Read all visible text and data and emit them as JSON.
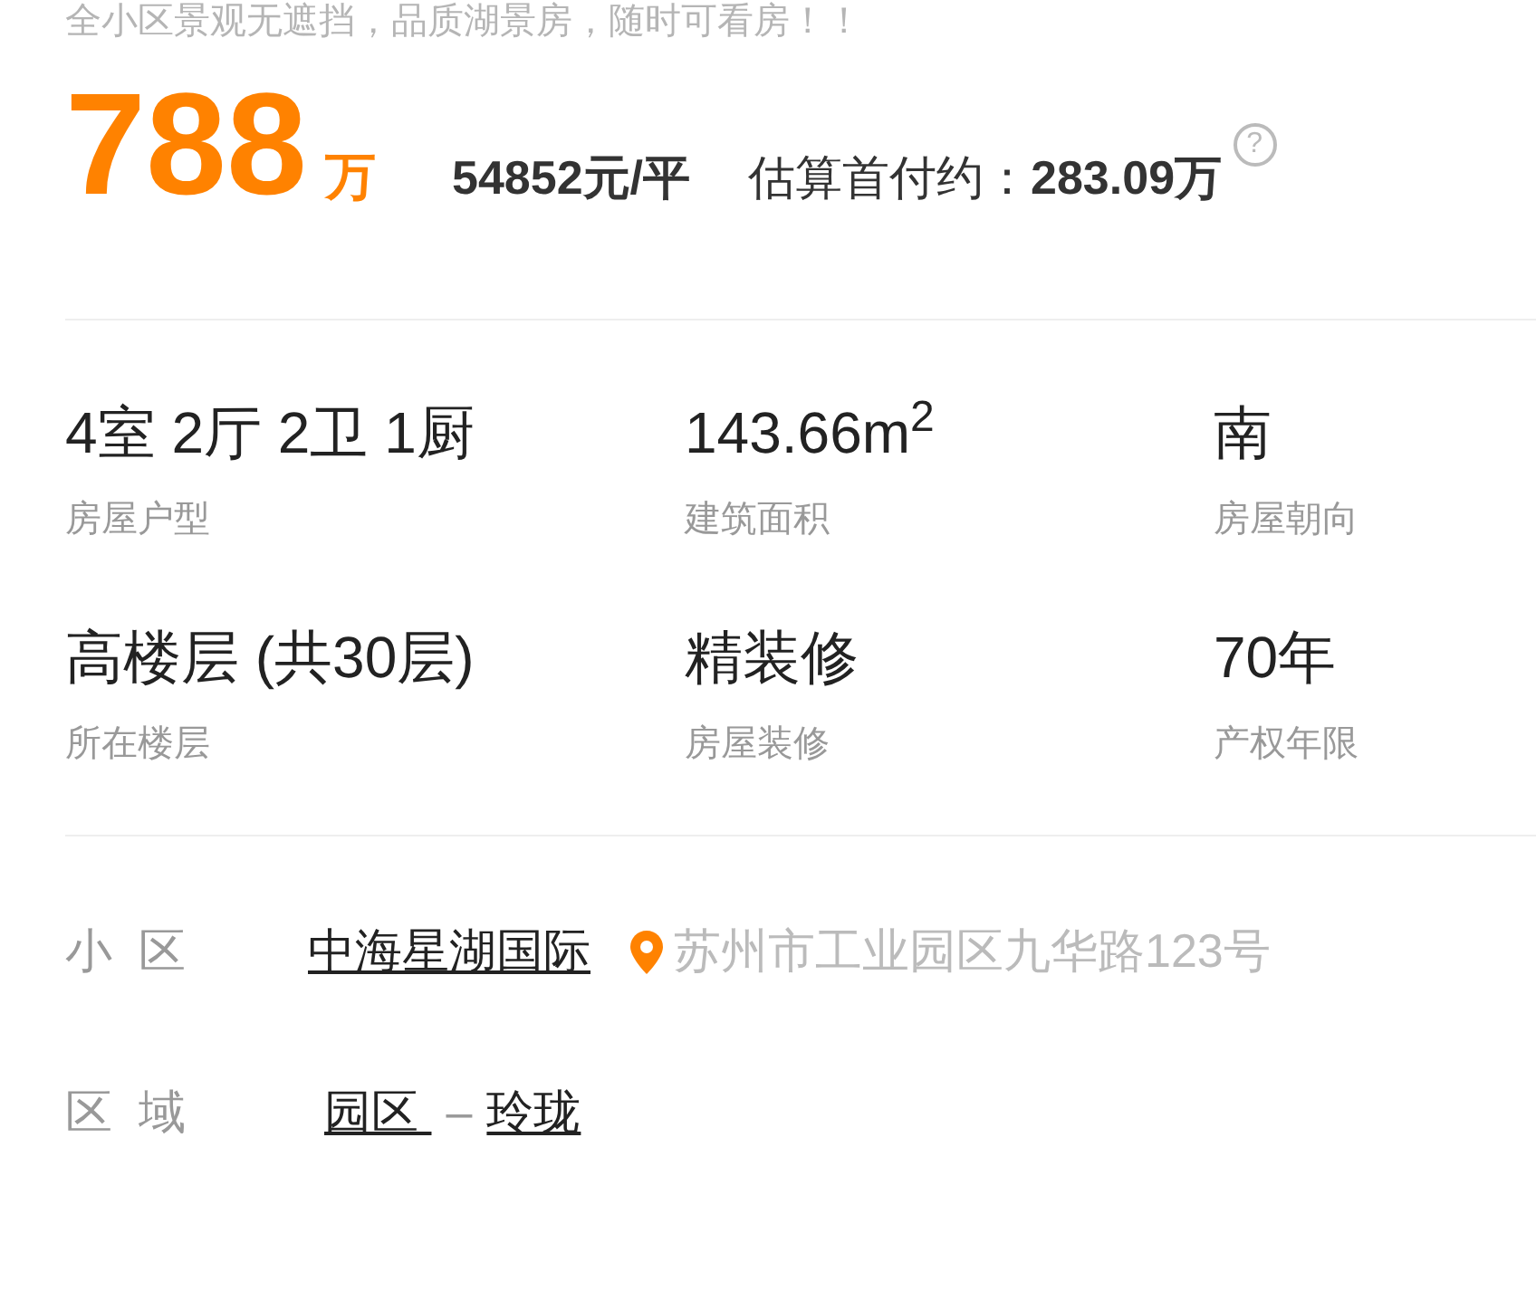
{
  "subtitle": "全小区景观无遮挡，品质湖景房，随时可看房！！",
  "price": {
    "total": "788",
    "unit": "万",
    "unit_price": "54852元/平",
    "down_payment_label": "估算首付约：",
    "down_payment": "283.09万",
    "help_icon": "?"
  },
  "attributes": [
    {
      "value": "4室 2厅 2卫 1厨",
      "label": "房屋户型"
    },
    {
      "value": "143.66m$^{2}$",
      "label": "建筑面积"
    },
    {
      "value": "南",
      "label": "房屋朝向"
    },
    {
      "value": "高楼层 (共30层)",
      "label": "所在楼层"
    },
    {
      "value": "精装修",
      "label": "房屋装修"
    },
    {
      "value": "70年",
      "label": "产权年限"
    }
  ],
  "community": {
    "label": "小  区",
    "name": "中海星湖国际",
    "address": "苏州市工业园区九华路123号"
  },
  "area": {
    "label": "区  域",
    "district": "园区 ",
    "separator": "–",
    "block": "玲珑"
  }
}
